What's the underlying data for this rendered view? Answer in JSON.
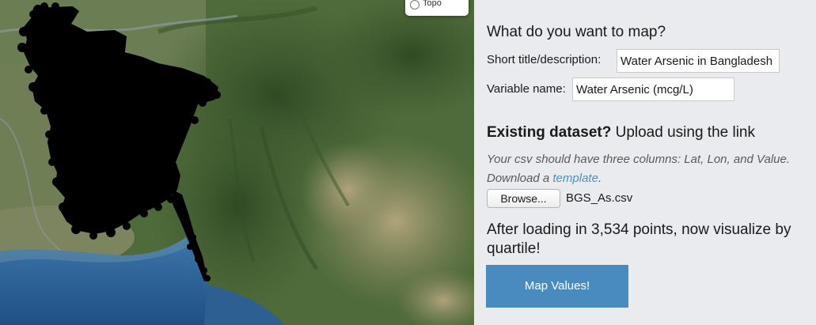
{
  "map": {
    "layer_control": {
      "option_label": "Topo"
    }
  },
  "form": {
    "heading": "What do you want to map?",
    "title_label": "Short title/description:",
    "title_value": "Water Arsenic in Bangladesh",
    "variable_label": "Variable name:",
    "variable_value": "Water Arsenic (mcg/L)"
  },
  "upload": {
    "heading_bold": "Existing dataset?",
    "heading_rest": " Upload using the link",
    "note_line1": "Your csv should have three columns: Lat, Lon, and Value.",
    "note_download": "Download a ",
    "note_link": "template",
    "note_period": ".",
    "browse_label": "Browse...",
    "file_name": "BGS_As.csv"
  },
  "status": {
    "message": "After loading in 3,534 points, now visualize by quartile!"
  },
  "actions": {
    "map_values_label": "Map Values!"
  },
  "colors": {
    "panel_bg": "#e9ebee",
    "link": "#4a8fc8",
    "button": "#4a8bbf",
    "data_points": "#000000"
  }
}
